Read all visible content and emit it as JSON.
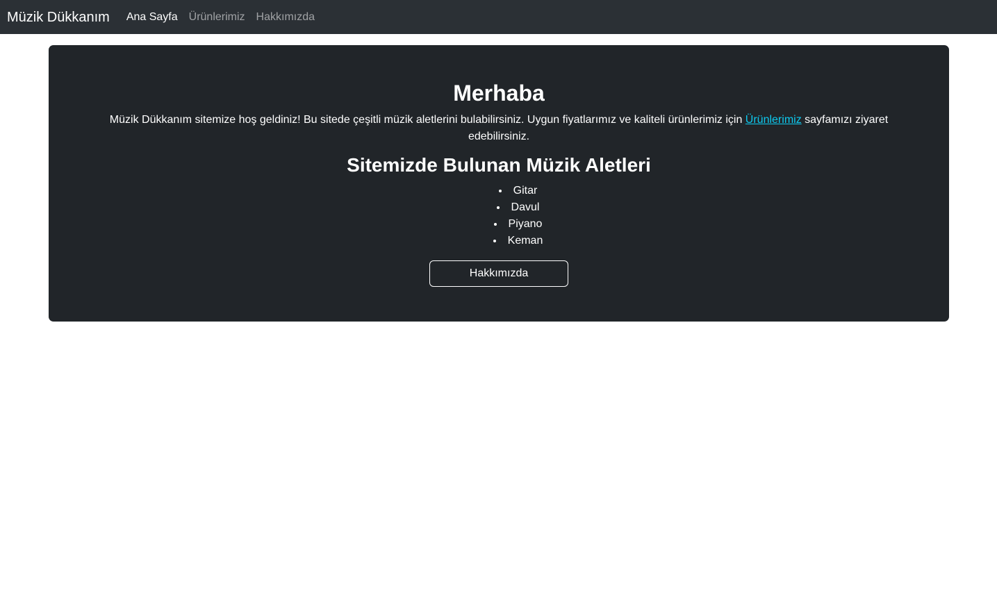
{
  "navbar": {
    "brand": "Müzik Dükkanım",
    "links": [
      {
        "label": "Ana Sayfa",
        "active": true
      },
      {
        "label": "Ürünlerimiz",
        "active": false
      },
      {
        "label": "Hakkımızda",
        "active": false
      }
    ]
  },
  "hero": {
    "title": "Merhaba",
    "text_before": "Müzik Dükkanım sitemize hoş geldiniz! Bu sitede çeşitli müzik aletlerini bulabilirsiniz. Uygun fiyatlarımız ve kaliteli ürünlerimiz için ",
    "link_label": "Ürünlerimiz",
    "text_after": " sayfamızı ziyaret edebilirsiniz.",
    "section_title": "Sitemizde Bulunan Müzik Aletleri",
    "instruments": [
      "Gitar",
      "Davul",
      "Piyano",
      "Keman"
    ],
    "button_label": "Hakkımızda"
  },
  "colors": {
    "navbar_bg": "#2b3035",
    "hero_bg": "#212529",
    "link": "#0dcaf0"
  }
}
